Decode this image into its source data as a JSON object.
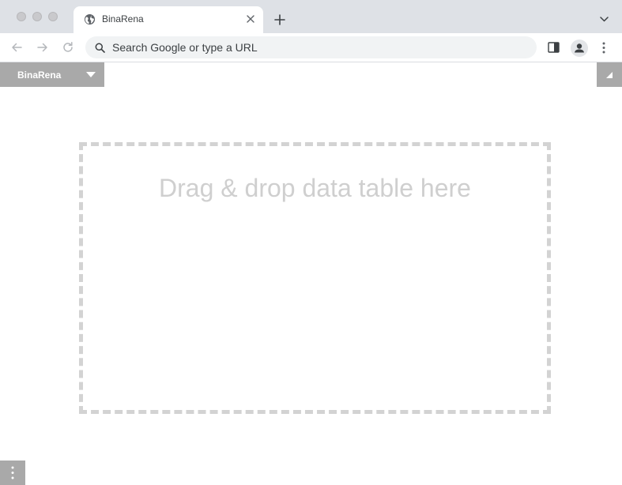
{
  "browser": {
    "tab": {
      "title": "BinaRena",
      "favicon": "globe-icon"
    },
    "omnibox": {
      "placeholder": "Search Google or type a URL"
    },
    "icons": [
      "back-icon",
      "forward-icon",
      "reload-icon",
      "search-icon",
      "side-panel-icon",
      "profile-icon",
      "more-menu-icon",
      "new-tab-icon",
      "tab-search-icon",
      "close-icon"
    ]
  },
  "app": {
    "menu": {
      "label": "BinaRena",
      "caret_icon": "caret-down-icon"
    },
    "corner_button_icon": "corner-triangle-icon",
    "dropzone": {
      "text": "Drag & drop data table here"
    },
    "bottom_button_icon": "vertical-dots-icon"
  },
  "colors": {
    "chrome_bg": "#dee1e6",
    "button_gray": "#a9a9a9",
    "dropzone_border": "#d3d3d3",
    "dropzone_text": "#cfcfcf"
  }
}
